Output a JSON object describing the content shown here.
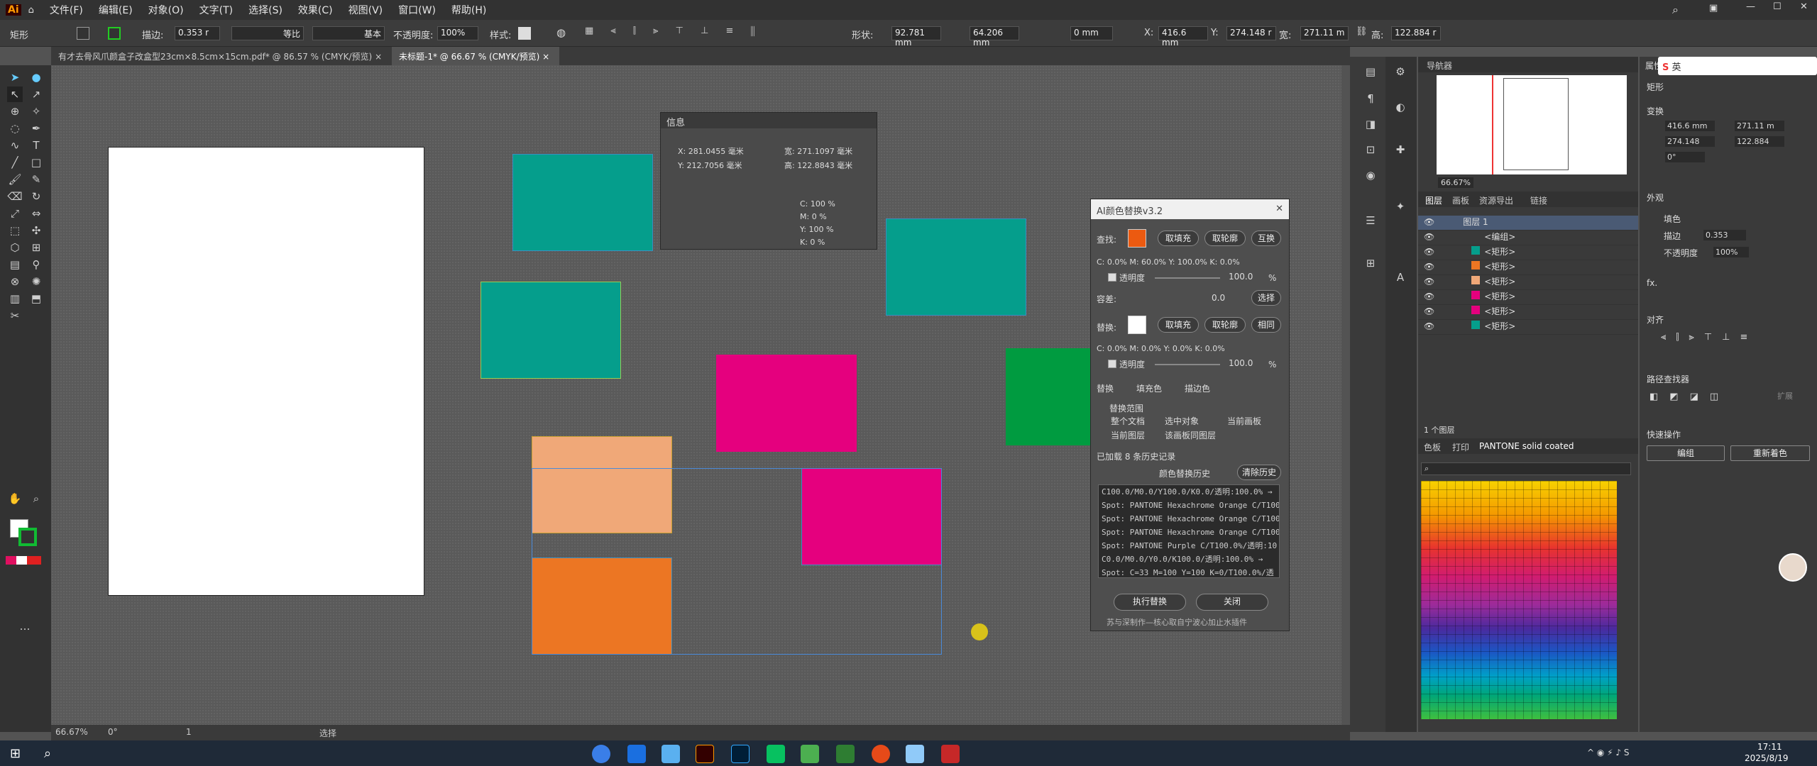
{
  "menubar": {
    "logo": "Ai",
    "items": [
      "文件(F)",
      "编辑(E)",
      "对象(O)",
      "文字(T)",
      "选择(S)",
      "效果(C)",
      "视图(V)",
      "窗口(W)",
      "帮助(H)"
    ]
  },
  "control": {
    "object_label": "矩形",
    "stroke_label": "描边:",
    "stroke_value": "0.353 r",
    "uniform": "等比",
    "basic": "基本",
    "opacity_label": "不透明度:",
    "opacity_value": "100%",
    "style_label": "样式:",
    "shape_label": "形状:",
    "w1": "92.781 mm",
    "w2": "64.206 mm",
    "corner": "0 mm",
    "x_label": "X:",
    "x_value": "416.6 mm",
    "y_label": "Y:",
    "y_value": "274.148 r",
    "w_label": "宽:",
    "w_value": "271.11 m",
    "h_label": "高:",
    "h_value": "122.884 r"
  },
  "tabs": [
    {
      "label": "有才去骨风爪颜盒子改盒型23cm×8.5cm×15cm.pdf* @ 86.57 % (CMYK/预览)"
    },
    {
      "label": "未标题-1* @ 66.67 % (CMYK/预览)"
    }
  ],
  "info": {
    "title": "信息",
    "x": "X: 281.0455 毫米",
    "y": "Y: 212.7056 毫米",
    "w": "宽: 271.1097 毫米",
    "h": "高: 122.8843 毫米",
    "c": "C: 100 %",
    "m": "M: 0 %",
    "yy": "Y: 100 %",
    "k": "K: 0 %"
  },
  "colorrep": {
    "title": "AI颜色替换v3.2",
    "find_label": "查找:",
    "fill_btn": "取填充",
    "stroke_btn": "取轮廓",
    "swap_btn": "互换",
    "find_cmyk": "C: 0.0% M: 60.0% Y: 100.0% K: 0.0%",
    "opacity_label": "透明度",
    "opacity_val": "100.0",
    "pct": "%",
    "tolerance_label": "容差:",
    "tolerance_val": "0.0",
    "select_btn": "选择",
    "replace_label": "替换:",
    "same_btn": "相同",
    "rep_cmyk": "C: 0.0% M: 0.0% Y: 0.0% K: 0.0%",
    "opacity2_val": "100.0",
    "mode_label": "替换",
    "fill_chk": "填充色",
    "stroke_chk": "描边色",
    "range_label": "替换范围",
    "r1": "整个文档",
    "r2": "选中对象",
    "r3": "当前画板",
    "r4": "当前图层",
    "r5": "该画板同图层",
    "loaded": "已加载 8 条历史记录",
    "history_label": "颜色替换历史",
    "clear_btn": "清除历史",
    "history": [
      "C100.0/M0.0/Y100.0/K0.0/透明:100.0% →",
      "Spot: PANTONE Hexachrome Orange C/T100",
      "Spot: PANTONE Hexachrome Orange C/T100",
      "Spot: PANTONE Hexachrome Orange C/T100",
      "Spot: PANTONE Purple C/T100.0%/透明:10",
      "C0.0/M0.0/Y0.0/K100.0/透明:100.0% →",
      "Spot: C=33 M=100 Y=100 K=0/T100.0%/透"
    ],
    "run_btn": "执行替换",
    "close_btn": "关闭",
    "footer": "苏与深制作—核心取自宁波心加止水插件"
  },
  "navigator": {
    "title": "导航器",
    "zoom": "66.67%"
  },
  "layers": {
    "tabs": [
      "图层",
      "画板",
      "资源导出",
      "链接"
    ],
    "rows": [
      "图层 1",
      "<编组>",
      "<矩形>",
      "<矩形>",
      "<矩形>",
      "<矩形>",
      "<矩形>",
      "<矩形>"
    ],
    "count": "1 个图层"
  },
  "swatch_tabs": [
    "色板",
    "打印",
    "PANTONE solid coated"
  ],
  "props": {
    "title": "属性",
    "object": "矩形",
    "transform": "变换",
    "x": "416.6 mm",
    "y": "274.148",
    "w": "271.11 m",
    "h": "122.884",
    "angle": "0°",
    "appearance": "外观",
    "fill": "填色",
    "stroke": "描边",
    "stroke_val": "0.353",
    "opacity": "不透明度",
    "opacity_val": "100%",
    "fx": "fx.",
    "align": "对齐",
    "pathfinder": "路径查找器",
    "expand": "扩展",
    "quick": "快速操作",
    "group_btn": "编组",
    "recolor_btn": "重新着色"
  },
  "status": {
    "zoom": "66.67%",
    "angle": "0°",
    "page": "1",
    "mode": "选择"
  },
  "taskbar": {
    "time": "17:11",
    "date": "2025/8/19"
  },
  "ime": {
    "label": "英"
  },
  "colors": {
    "teal": "#059e8c",
    "magenta": "#e5007e",
    "peach": "#f0a878",
    "orange": "#ec7623",
    "green": "#009b40"
  }
}
